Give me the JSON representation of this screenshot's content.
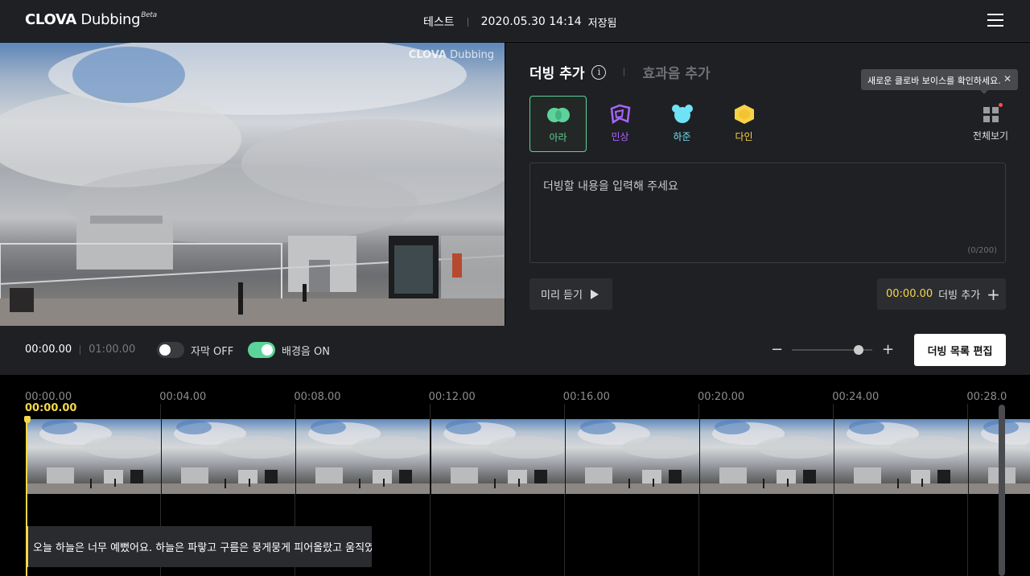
{
  "header": {
    "logo_brand": "CLOVA",
    "logo_product": "Dubbing",
    "logo_badge": "Beta",
    "project_name": "테스트",
    "saved_time": "2020.05.30 14:14",
    "saved_label": "저장됨",
    "menu_icon": "hamburger-menu-icon"
  },
  "video": {
    "watermark_brand": "CLOVA",
    "watermark_product": "Dubbing"
  },
  "panel": {
    "tab_dubbing": "더빙 추가",
    "tab_effects": "효과음 추가",
    "tooltip_text": "새로운 클로바 보이스를 확인하세요.",
    "voices": [
      {
        "name": "아라",
        "color": "#5cd39a",
        "icon": "ara-voice-icon"
      },
      {
        "name": "민상",
        "color": "#a764ff",
        "icon": "minsang-voice-icon"
      },
      {
        "name": "하준",
        "color": "#6fe3f5",
        "icon": "hajun-voice-icon"
      },
      {
        "name": "다인",
        "color": "#f7d34a",
        "icon": "dain-voice-icon"
      }
    ],
    "all_view_label": "전체보기",
    "text_placeholder": "더빙할 내용을 입력해 주세요",
    "char_count": "(0/200)",
    "preview_label": "미리 듣기",
    "add_time": "00:00.00",
    "add_label": "더빙 추가"
  },
  "controls": {
    "current_time": "00:00.00",
    "total_time": "01:00.00",
    "subtitle_toggle_label": "자막 OFF",
    "subtitle_on": false,
    "bgm_toggle_label": "배경음 ON",
    "bgm_on": true,
    "zoom_level": 0.83,
    "edit_list_label": "더빙 목록 편집"
  },
  "timeline": {
    "ticks": [
      "00:00.00",
      "00:04.00",
      "00:08.00",
      "00:12.00",
      "00:16.00",
      "00:20.00",
      "00:24.00",
      "00:28.0"
    ],
    "playhead_time": "00:00.00",
    "subtitle_clip_text": "오늘 하늘은 너무 예뻤어요. 하늘은 파랗고 구름은 뭉게뭉게 피어올랐고 움직였"
  },
  "colors": {
    "accent_yellow": "#f5d84a",
    "accent_green": "#5cd39a",
    "panel_bg": "#1f2023"
  }
}
